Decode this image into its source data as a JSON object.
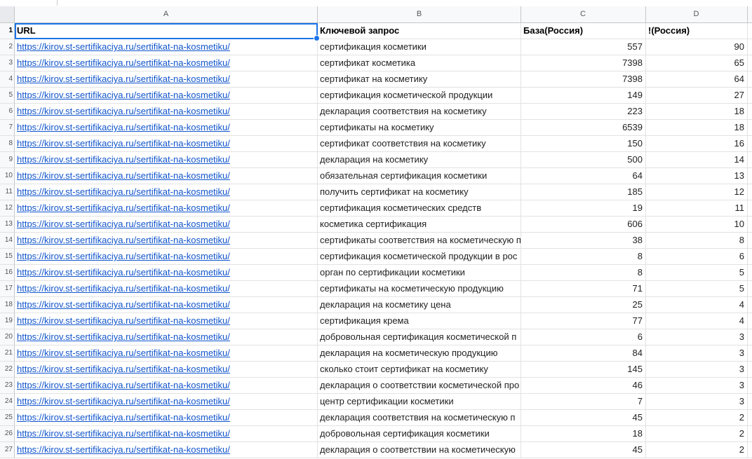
{
  "columns": [
    "A",
    "B",
    "C",
    "D"
  ],
  "header": {
    "url": "URL",
    "keyword": "Ключевой запрос",
    "base": "База(Россия)",
    "exact": "!(Россия)"
  },
  "rows": [
    {
      "n": "2",
      "url": "https://kirov.st-sertifikaciya.ru/sertifikat-na-kosmetiku/",
      "keyword": "сертификация косметики",
      "base": "557",
      "exact": "90"
    },
    {
      "n": "3",
      "url": "https://kirov.st-sertifikaciya.ru/sertifikat-na-kosmetiku/",
      "keyword": "сертификат косметика",
      "base": "7398",
      "exact": "65"
    },
    {
      "n": "4",
      "url": "https://kirov.st-sertifikaciya.ru/sertifikat-na-kosmetiku/",
      "keyword": "сертификат на косметику",
      "base": "7398",
      "exact": "64"
    },
    {
      "n": "5",
      "url": "https://kirov.st-sertifikaciya.ru/sertifikat-na-kosmetiku/",
      "keyword": "сертификация косметической продукции",
      "base": "149",
      "exact": "27"
    },
    {
      "n": "6",
      "url": "https://kirov.st-sertifikaciya.ru/sertifikat-na-kosmetiku/",
      "keyword": "декларация соответствия на косметику",
      "base": "223",
      "exact": "18"
    },
    {
      "n": "7",
      "url": "https://kirov.st-sertifikaciya.ru/sertifikat-na-kosmetiku/",
      "keyword": "сертификаты на косметику",
      "base": "6539",
      "exact": "18"
    },
    {
      "n": "8",
      "url": "https://kirov.st-sertifikaciya.ru/sertifikat-na-kosmetiku/",
      "keyword": "сертификат соответствия на косметику",
      "base": "150",
      "exact": "16"
    },
    {
      "n": "9",
      "url": "https://kirov.st-sertifikaciya.ru/sertifikat-na-kosmetiku/",
      "keyword": "декларация на косметику",
      "base": "500",
      "exact": "14"
    },
    {
      "n": "10",
      "url": "https://kirov.st-sertifikaciya.ru/sertifikat-na-kosmetiku/",
      "keyword": "обязательная сертификация косметики",
      "base": "64",
      "exact": "13"
    },
    {
      "n": "11",
      "url": "https://kirov.st-sertifikaciya.ru/sertifikat-na-kosmetiku/",
      "keyword": "получить сертификат на косметику",
      "base": "185",
      "exact": "12"
    },
    {
      "n": "12",
      "url": "https://kirov.st-sertifikaciya.ru/sertifikat-na-kosmetiku/",
      "keyword": "сертификация косметических средств",
      "base": "19",
      "exact": "11"
    },
    {
      "n": "13",
      "url": "https://kirov.st-sertifikaciya.ru/sertifikat-na-kosmetiku/",
      "keyword": "косметика сертификация",
      "base": "606",
      "exact": "10"
    },
    {
      "n": "14",
      "url": "https://kirov.st-sertifikaciya.ru/sertifikat-na-kosmetiku/",
      "keyword": "сертификаты соответствия на косметическую п",
      "base": "38",
      "exact": "8"
    },
    {
      "n": "15",
      "url": "https://kirov.st-sertifikaciya.ru/sertifikat-na-kosmetiku/",
      "keyword": "сертификация косметической продукции в рос",
      "base": "8",
      "exact": "6"
    },
    {
      "n": "16",
      "url": "https://kirov.st-sertifikaciya.ru/sertifikat-na-kosmetiku/",
      "keyword": "орган по сертификации косметики",
      "base": "8",
      "exact": "5"
    },
    {
      "n": "17",
      "url": "https://kirov.st-sertifikaciya.ru/sertifikat-na-kosmetiku/",
      "keyword": "сертификаты на косметическую продукцию",
      "base": "71",
      "exact": "5"
    },
    {
      "n": "18",
      "url": "https://kirov.st-sertifikaciya.ru/sertifikat-na-kosmetiku/",
      "keyword": "декларация на косметику цена",
      "base": "25",
      "exact": "4"
    },
    {
      "n": "19",
      "url": "https://kirov.st-sertifikaciya.ru/sertifikat-na-kosmetiku/",
      "keyword": "сертификация крема",
      "base": "77",
      "exact": "4"
    },
    {
      "n": "20",
      "url": "https://kirov.st-sertifikaciya.ru/sertifikat-na-kosmetiku/",
      "keyword": "добровольная сертификация косметической п",
      "base": "6",
      "exact": "3"
    },
    {
      "n": "21",
      "url": "https://kirov.st-sertifikaciya.ru/sertifikat-na-kosmetiku/",
      "keyword": "декларация на косметическую продукцию",
      "base": "84",
      "exact": "3"
    },
    {
      "n": "22",
      "url": "https://kirov.st-sertifikaciya.ru/sertifikat-na-kosmetiku/",
      "keyword": "сколько стоит сертификат на косметику",
      "base": "145",
      "exact": "3"
    },
    {
      "n": "23",
      "url": "https://kirov.st-sertifikaciya.ru/sertifikat-na-kosmetiku/",
      "keyword": "декларация о соответствии косметической про",
      "base": "46",
      "exact": "3"
    },
    {
      "n": "24",
      "url": "https://kirov.st-sertifikaciya.ru/sertifikat-na-kosmetiku/",
      "keyword": "центр сертификации косметики",
      "base": "7",
      "exact": "3"
    },
    {
      "n": "25",
      "url": "https://kirov.st-sertifikaciya.ru/sertifikat-na-kosmetiku/",
      "keyword": "декларация соответствия на косметическую п",
      "base": "45",
      "exact": "2"
    },
    {
      "n": "26",
      "url": "https://kirov.st-sertifikaciya.ru/sertifikat-na-kosmetiku/",
      "keyword": "добровольная сертификация косметики",
      "base": "18",
      "exact": "2"
    },
    {
      "n": "27",
      "url": "https://kirov.st-sertifikaciya.ru/sertifikat-na-kosmetiku/",
      "keyword": "декларация о соответствии на косметическую",
      "base": "45",
      "exact": "2"
    }
  ]
}
